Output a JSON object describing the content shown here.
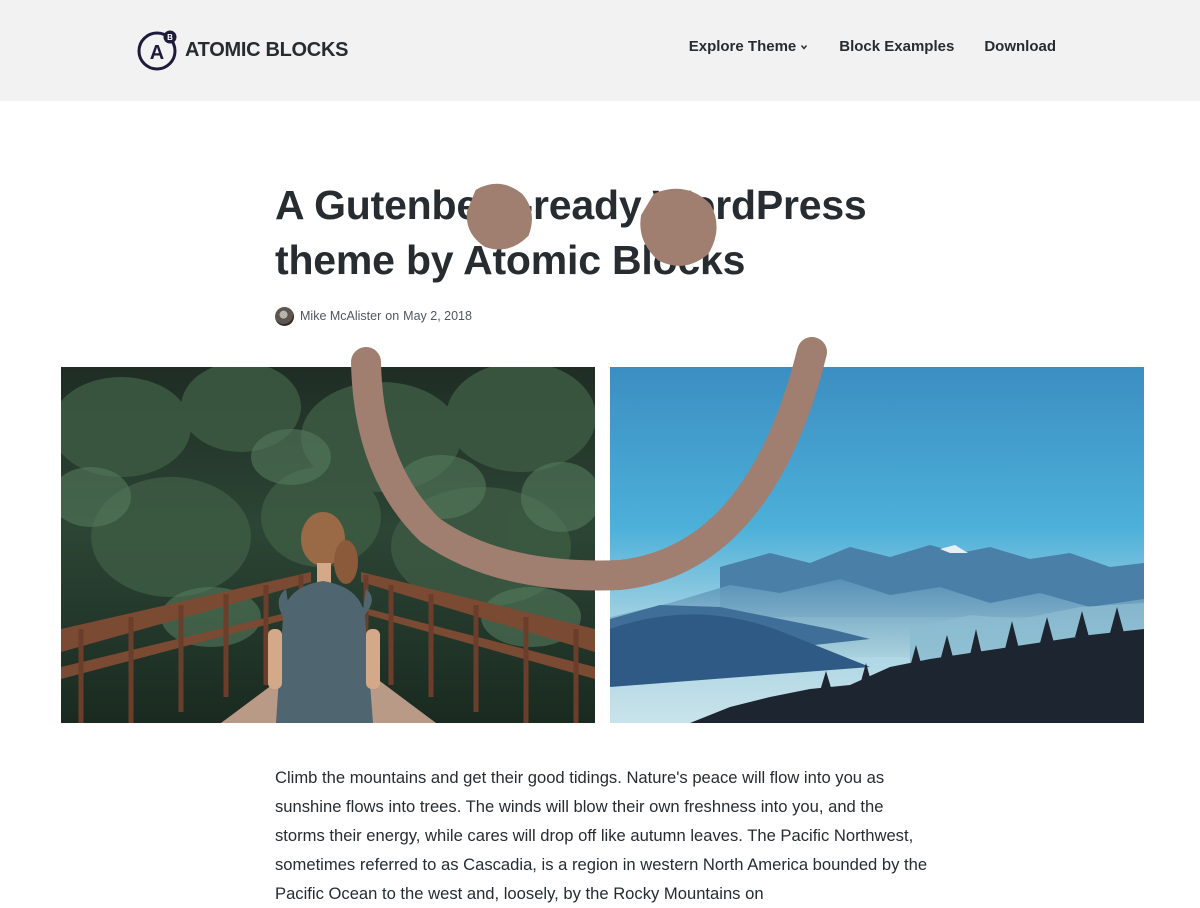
{
  "header": {
    "brand": {
      "logo_letter": "A",
      "logo_sub": "B",
      "name": "ATOMIC BLOCKS"
    },
    "nav": [
      {
        "label": "Explore Theme",
        "has_dropdown": true
      },
      {
        "label": "Block Examples"
      },
      {
        "label": "Download"
      }
    ]
  },
  "post": {
    "title": "A Gutenberg-ready WordPress theme by Atomic Blocks",
    "author": "Mike McAlister",
    "date_prefix": "on",
    "date": "May 2, 2018",
    "gallery": [
      {
        "icon": "forest-bridge-photo"
      },
      {
        "icon": "misty-mountains-photo"
      }
    ],
    "body": "Climb the mountains and get their good tidings. Nature's peace will flow into you as sunshine flows into trees. The winds will blow their own freshness into you, and the storms their energy, while cares will drop off like autumn leaves. The Pacific Northwest, sometimes referred to as Cascadia, is a region in western North America bounded by the Pacific Ocean to the west and, loosely, by the Rocky Mountains on"
  },
  "colors": {
    "header_bg": "#f2f2f2",
    "text": "#272c30",
    "brand_navy": "#1e1b3a",
    "doodle": "#a07f70"
  }
}
